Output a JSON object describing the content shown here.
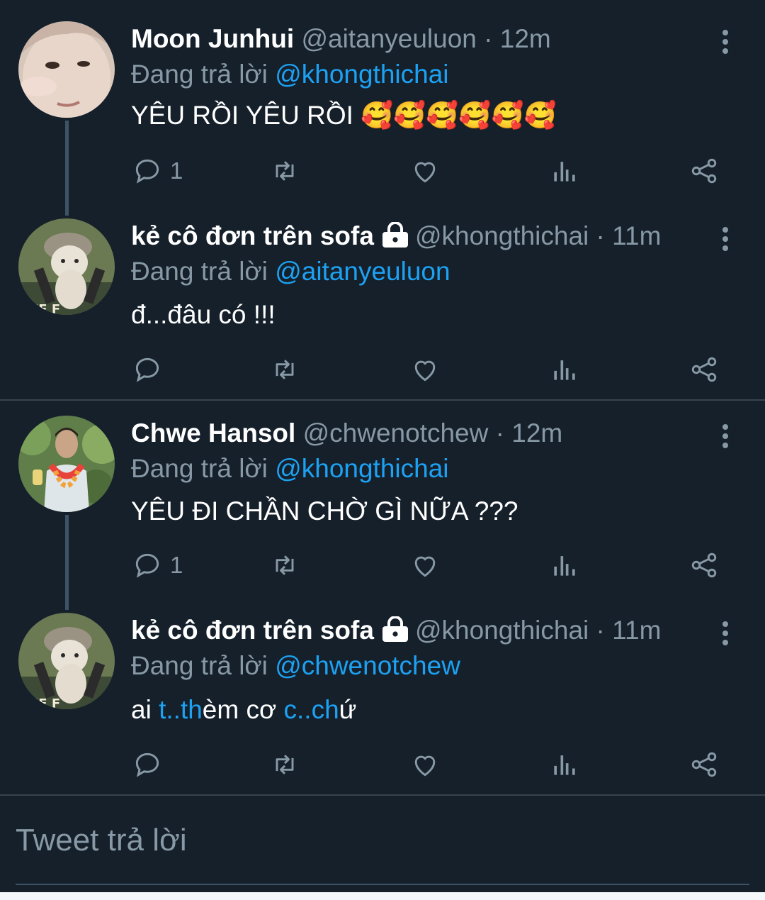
{
  "tweets": [
    {
      "name": "Moon Junhui",
      "handle": "@aitanyeuluon",
      "dot": " · ",
      "time": "12m",
      "replying_prefix": "Đang trả lời ",
      "replying_to": "@khongthichai",
      "text": "YÊU RỒI YÊU RỒI ",
      "emoji": "🥰🥰🥰🥰🥰🥰",
      "reply_count": "1",
      "locked": false
    },
    {
      "name": "kẻ cô đơn trên sofa",
      "handle": "@khongthichai",
      "dot": " · ",
      "time": "11m",
      "replying_prefix": "Đang trả lời ",
      "replying_to": "@aitanyeuluon",
      "text": "đ...đâu có !!!",
      "reply_count": "",
      "locked": true
    },
    {
      "name": "Chwe Hansol",
      "handle": "@chwenotchew",
      "dot": " · ",
      "time": "12m",
      "replying_prefix": "Đang trả lời ",
      "replying_to": "@khongthichai",
      "text": "YÊU ĐI CHẦN CHỜ GÌ NỮA ???",
      "reply_count": "1",
      "locked": false
    },
    {
      "name": "kẻ cô đơn trên sofa",
      "handle": "@khongthichai",
      "dot": " · ",
      "time": "11m",
      "replying_prefix": "Đang trả lời ",
      "replying_to": "@chwenotchew",
      "text_parts": [
        "ai ",
        "t..th",
        "èm cơ ",
        "c..ch",
        "ứ"
      ],
      "reply_count": "",
      "locked": true
    }
  ],
  "compose": {
    "placeholder": "Tweet trả lời"
  },
  "icons": {
    "reply": "reply-icon",
    "retweet": "retweet-icon",
    "like": "like-icon",
    "analytics": "analytics-icon",
    "share": "share-icon",
    "more": "more-vertical-icon",
    "lock": "lock-icon"
  },
  "colors": {
    "background": "#15202b",
    "accent": "#1da1f2",
    "secondary_text": "#8899a6",
    "divider": "#38444d"
  }
}
